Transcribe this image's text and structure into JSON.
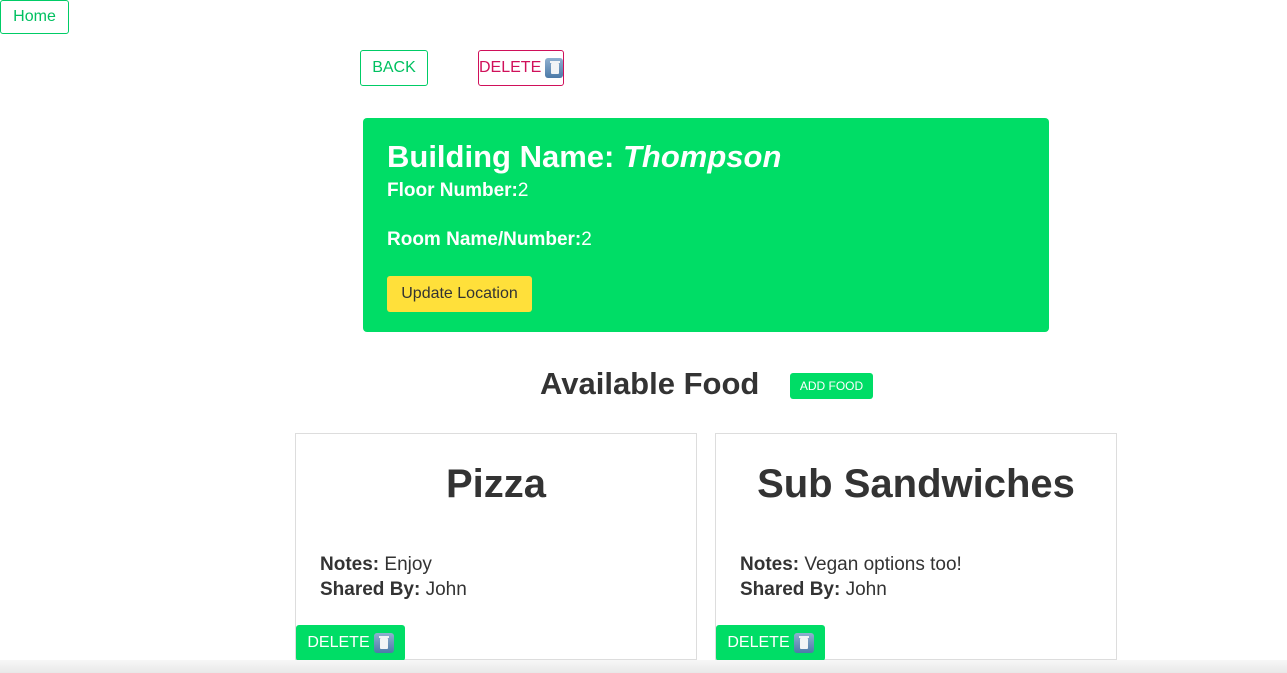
{
  "nav": {
    "home_label": "Home"
  },
  "actions": {
    "back_label": "BACK",
    "delete_label": "DELETE"
  },
  "location": {
    "building_label": "Building Name:",
    "building_name": "Thompson",
    "floor_label": "Floor Number:",
    "floor_value": "2",
    "room_label": "Room Name/Number:",
    "room_value": "2",
    "update_label": "Update Location"
  },
  "food_section": {
    "heading": "Available Food",
    "add_label": "ADD FOOD"
  },
  "foods": [
    {
      "name": "Pizza",
      "notes_label": "Notes:",
      "notes": "Enjoy",
      "shared_label": "Shared By:",
      "shared_by": "John",
      "delete_label": "DELETE"
    },
    {
      "name": "Sub Sandwiches",
      "notes_label": "Notes:",
      "notes": "Vegan options too!",
      "shared_label": "Shared By:",
      "shared_by": "John",
      "delete_label": "DELETE"
    }
  ],
  "icons": {
    "delete": "trash-icon"
  },
  "colors": {
    "primary": "#00dd66",
    "danger": "#d0105a",
    "warning": "#ffe03a"
  }
}
